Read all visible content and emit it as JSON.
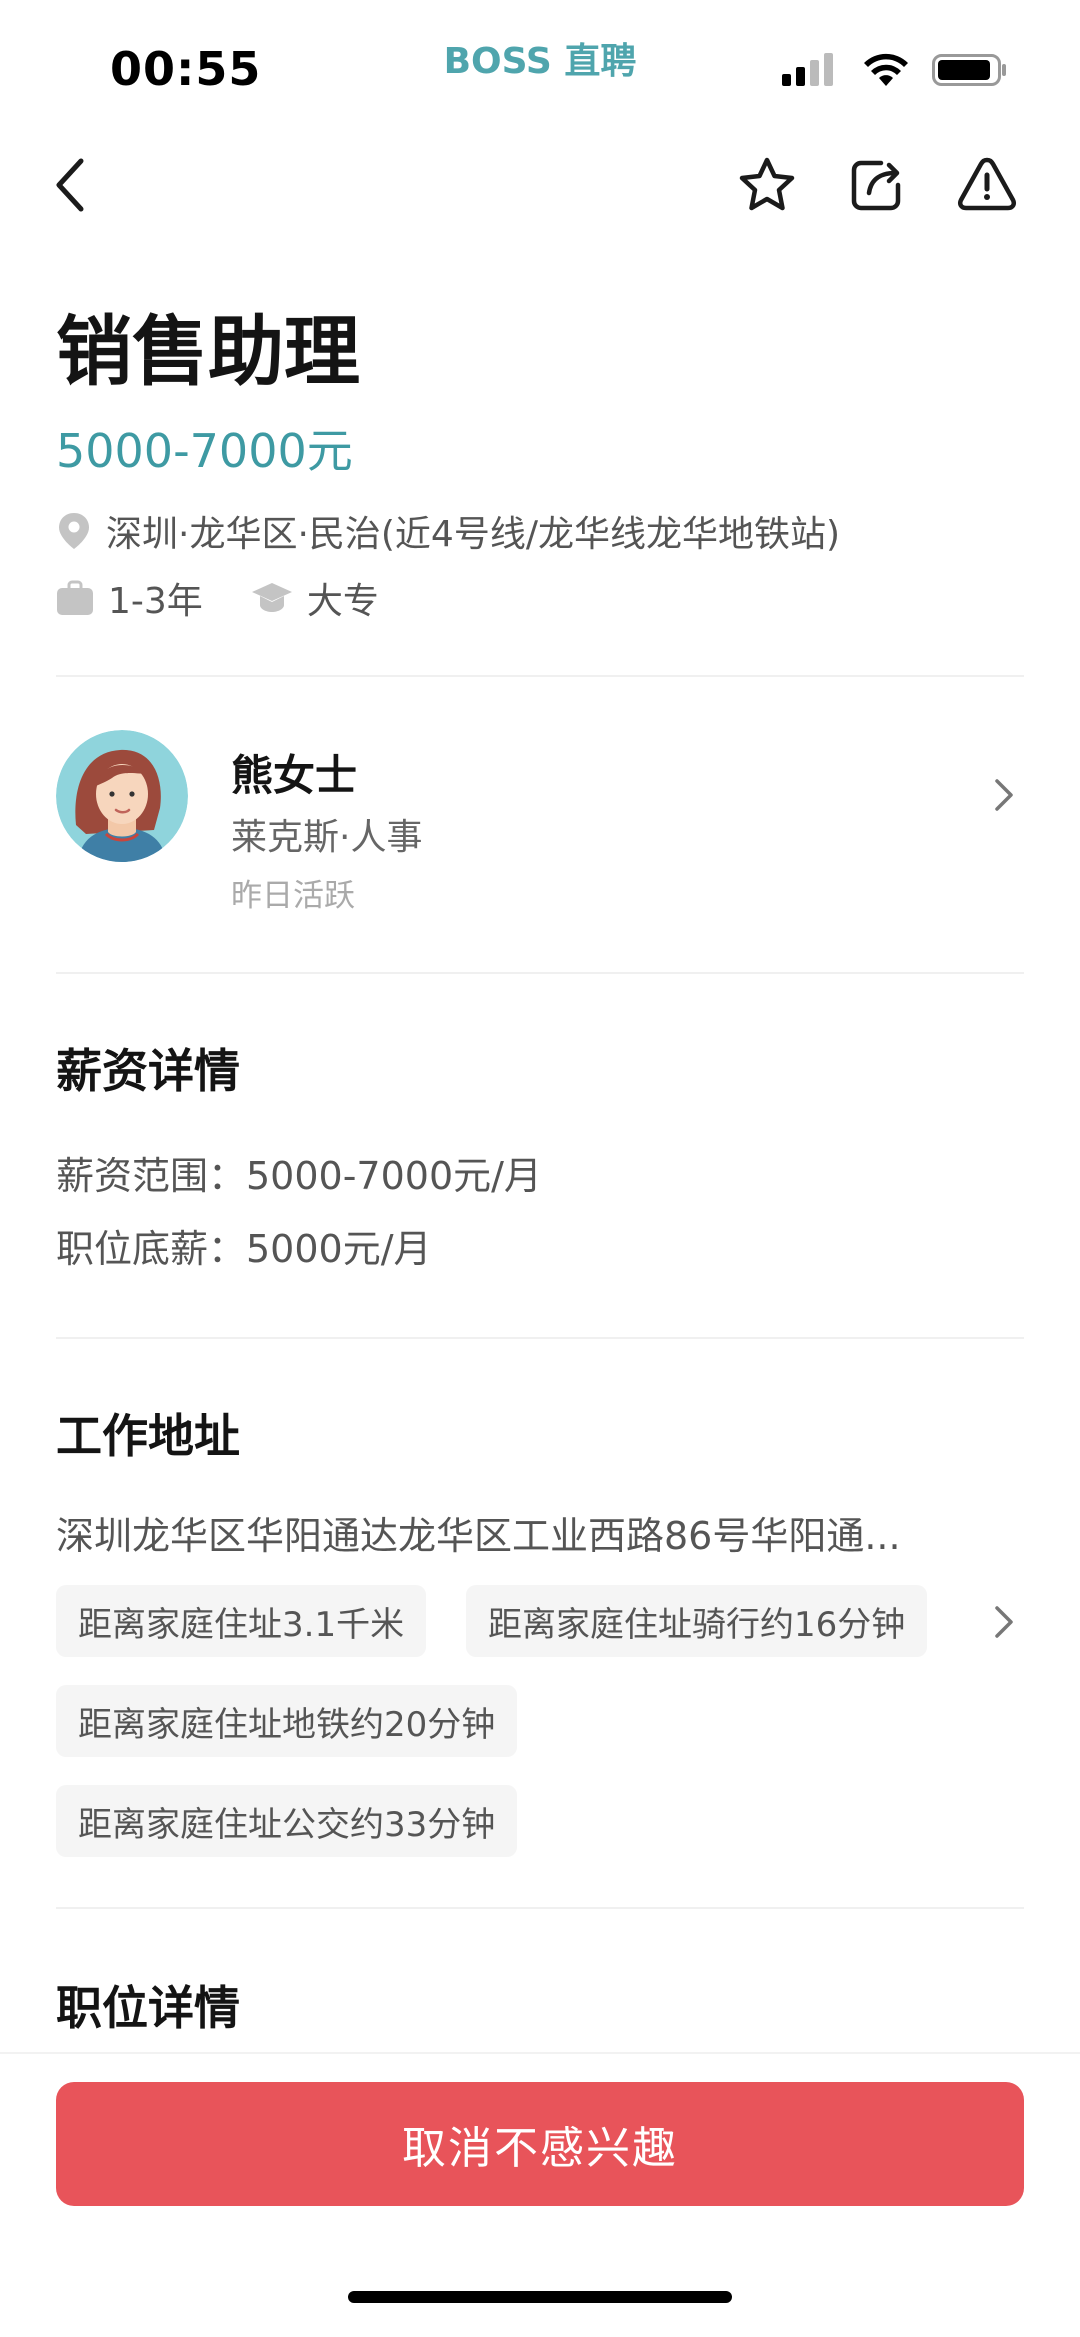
{
  "status_bar": {
    "time": "00:55",
    "brand": "BOSS 直聘",
    "icons": [
      "signal-icon",
      "wifi-icon",
      "battery-icon"
    ]
  },
  "nav": {
    "icons": [
      "back-icon",
      "star-icon",
      "share-icon",
      "report-icon"
    ]
  },
  "job": {
    "title": "销售助理",
    "salary": "5000-7000元",
    "location": "深圳·龙华区·民治(近4号线/龙华线龙华地铁站)",
    "experience": "1-3年",
    "education": "大专"
  },
  "recruiter": {
    "name": "熊女士",
    "company": "莱克斯·人事",
    "active": "昨日活跃"
  },
  "salary_details": {
    "title": "薪资详情",
    "range": "薪资范围：5000-7000元/月",
    "base": "职位底薪：5000元/月"
  },
  "work_address": {
    "title": "工作地址",
    "address": "深圳龙华区华阳通达龙华区工业西路86号华阳通...",
    "tags": [
      "距离家庭住址3.1千米",
      "距离家庭住址骑行约16分钟",
      "距离家庭住址地铁约20分钟",
      "距离家庭住址公交约33分钟"
    ]
  },
  "job_details": {
    "title": "职位详情"
  },
  "cta": {
    "label": "取消不感兴趣"
  },
  "colors": {
    "accent": "#3e9aa3",
    "brand": "#4fa5ad",
    "cta": "#e8545a"
  }
}
